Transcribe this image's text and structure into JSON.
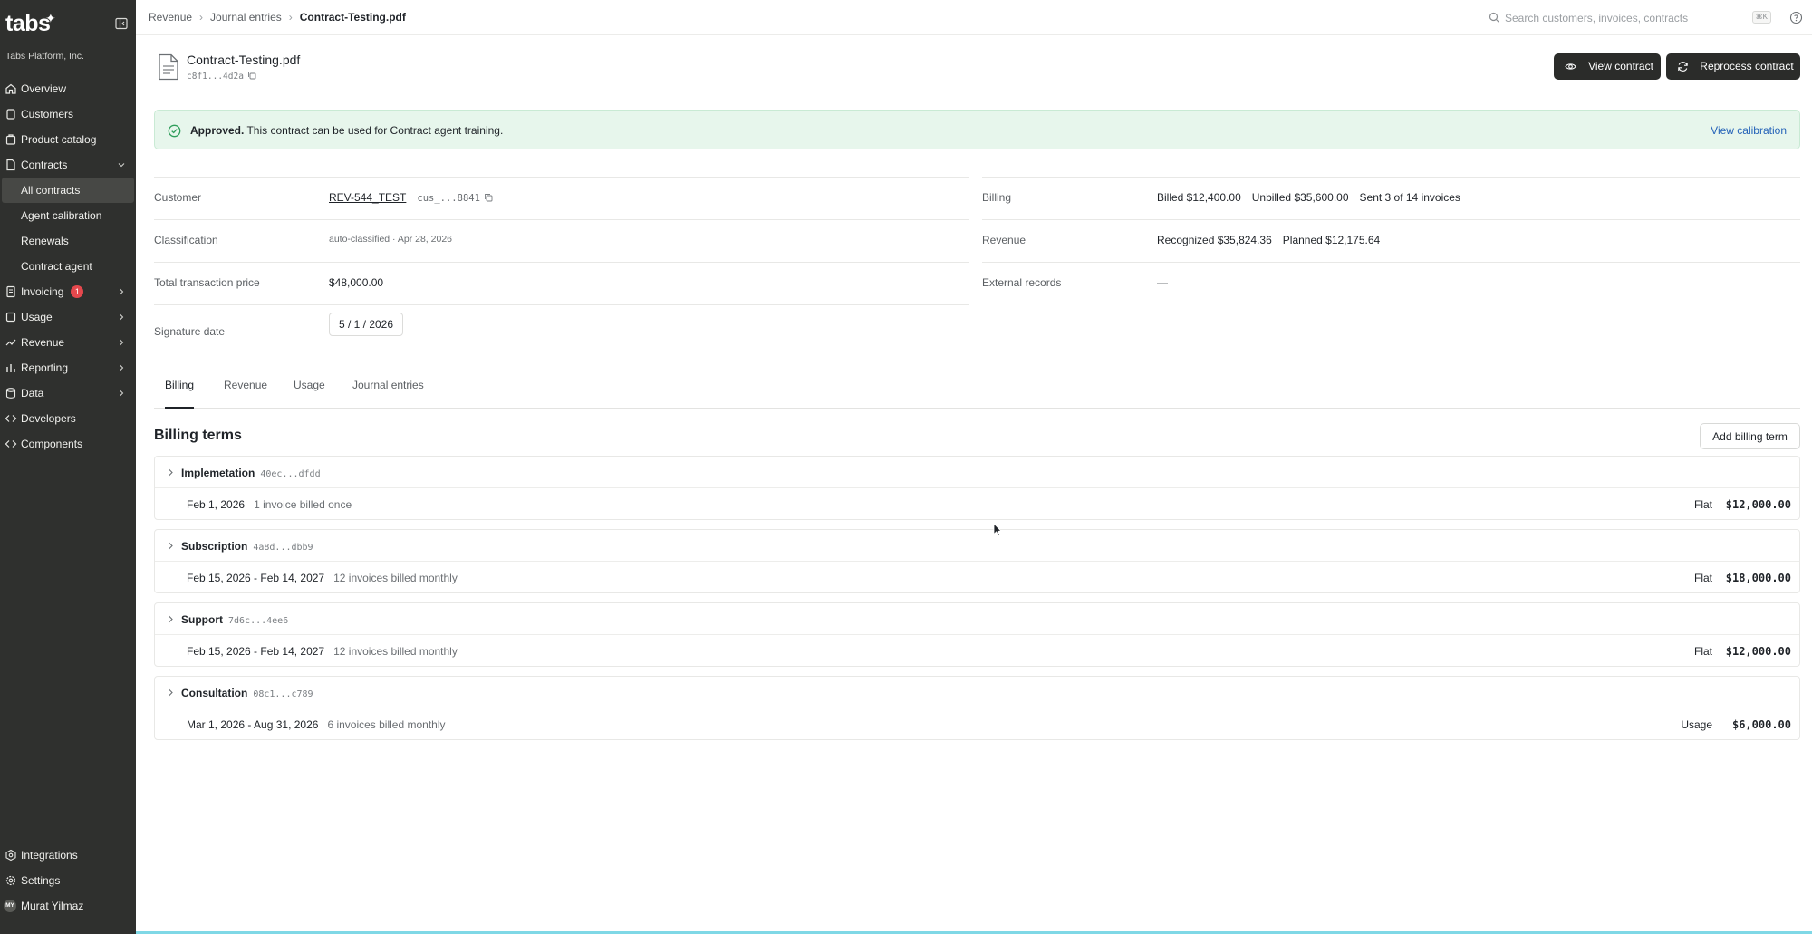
{
  "app": {
    "logo": "tabs",
    "org_name": "Tabs Platform, Inc."
  },
  "sidebar": {
    "items": [
      {
        "label": "Overview",
        "icon": "home-icon"
      },
      {
        "label": "Customers",
        "icon": "users-icon"
      },
      {
        "label": "Product catalog",
        "icon": "package-icon"
      },
      {
        "label": "Contracts",
        "icon": "document-icon",
        "expanded": true
      },
      {
        "label": "All contracts",
        "sub": true,
        "active": true
      },
      {
        "label": "Agent calibration",
        "sub": true
      },
      {
        "label": "Renewals",
        "sub": true
      },
      {
        "label": "Contract agent",
        "sub": true
      },
      {
        "label": "Invoicing",
        "icon": "invoice-icon",
        "badge": "1"
      },
      {
        "label": "Usage",
        "icon": "usage-icon"
      },
      {
        "label": "Revenue",
        "icon": "revenue-icon"
      },
      {
        "label": "Reporting",
        "icon": "chart-icon"
      },
      {
        "label": "Data",
        "icon": "database-icon"
      },
      {
        "label": "Developers",
        "icon": "code-icon"
      },
      {
        "label": "Components",
        "icon": "code-icon"
      }
    ],
    "bottom": [
      {
        "label": "Integrations",
        "icon": "integrations-icon"
      },
      {
        "label": "Settings",
        "icon": "gear-icon"
      },
      {
        "label": "Murat Yilmaz",
        "avatar": "MY"
      }
    ]
  },
  "topbar": {
    "breadcrumb": [
      "Revenue",
      "Journal entries",
      "Contract-Testing.pdf"
    ],
    "search_placeholder": "Search customers, invoices, contracts",
    "search_shortcut": "⌘K"
  },
  "contract": {
    "title": "Contract-Testing.pdf",
    "id": "c8f1...4d2a",
    "view_label": "View contract",
    "reprocess_label": "Reprocess contract"
  },
  "alert": {
    "strong": "Approved.",
    "text": " This contract can be used for Contract agent training.",
    "link": "View calibration",
    "color": "#e7f6ec"
  },
  "props": {
    "customer": {
      "label": "Customer",
      "name": "REV-544_TEST",
      "id": "cus_...8841"
    },
    "classification": {
      "label": "Classification",
      "value": "auto-classified · Apr 28, 2026"
    },
    "total": {
      "label": "Total transaction price",
      "value": "$48,000.00"
    },
    "signature": {
      "label": "Signature date",
      "value": "5 / 1 / 2026"
    },
    "billing": {
      "label": "Billing",
      "billed": "Billed $12,400.00",
      "unbilled": "Unbilled $35,600.00",
      "sent": "Sent 3 of 14 invoices"
    },
    "revenue": {
      "label": "Revenue",
      "recognized": "Recognized $35,824.36",
      "planned": "Planned $12,175.64"
    },
    "external": {
      "label": "External records",
      "value": "—"
    }
  },
  "tabs": [
    "Billing",
    "Revenue",
    "Usage",
    "Journal entries"
  ],
  "billing_section": {
    "title": "Billing terms",
    "add_label": "Add billing term"
  },
  "terms": [
    {
      "name": "Implemetation",
      "id": "40ec...dfdd",
      "dates": "Feb 1, 2026",
      "desc": "1 invoice billed once",
      "type": "Flat",
      "amount": "$12,000.00"
    },
    {
      "name": "Subscription",
      "id": "4a8d...dbb9",
      "dates": "Feb 15, 2026 - Feb 14, 2027",
      "desc": "12 invoices billed monthly",
      "type": "Flat",
      "amount": "$18,000.00"
    },
    {
      "name": "Support",
      "id": "7d6c...4ee6",
      "dates": "Feb 15, 2026 - Feb 14, 2027",
      "desc": "12 invoices billed monthly",
      "type": "Flat",
      "amount": "$12,000.00"
    },
    {
      "name": "Consultation",
      "id": "08c1...c789",
      "dates": "Mar 1, 2026 - Aug 31, 2026",
      "desc": "6 invoices billed monthly",
      "type": "Usage",
      "amount": "$6,000.00"
    }
  ]
}
